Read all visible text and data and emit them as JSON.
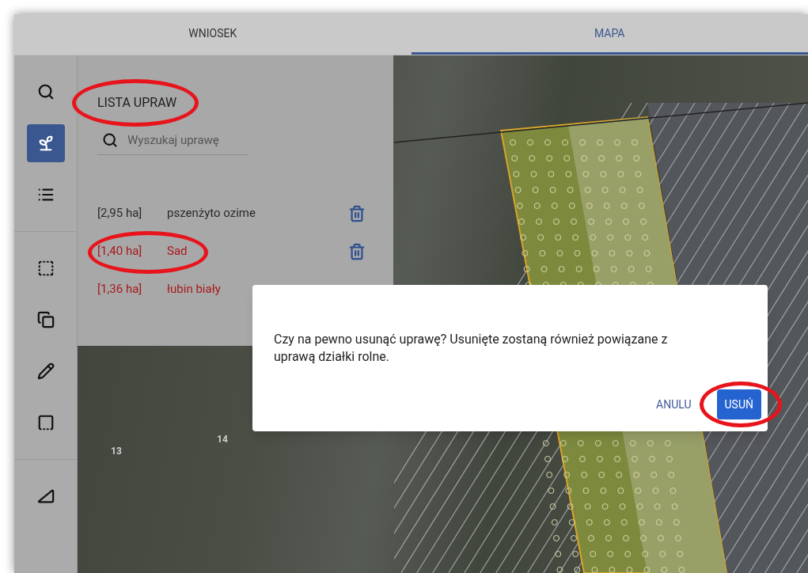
{
  "tabs": [
    {
      "label": "WNIOSEK",
      "selected": false
    },
    {
      "label": "MAPA",
      "selected": true
    }
  ],
  "toolbar": {
    "groups": [
      [
        {
          "kind": "search",
          "selected": false
        },
        {
          "kind": "crop",
          "selected": true
        },
        {
          "kind": "list",
          "selected": false
        }
      ],
      [
        {
          "kind": "select-area",
          "selected": false
        },
        {
          "kind": "copy",
          "selected": false
        },
        {
          "kind": "pencil",
          "selected": false
        },
        {
          "kind": "rectangle",
          "selected": false
        }
      ],
      [
        {
          "kind": "ruler",
          "selected": false
        }
      ]
    ]
  },
  "panel": {
    "title": "LISTA UPRAW",
    "title_highlighted": true,
    "search": {
      "placeholder": "Wyszukaj uprawę"
    },
    "crops": [
      {
        "area": "[2,95 ha]",
        "name": "pszenżyto ozime",
        "invalid": false,
        "deletable": true,
        "highlighted": false
      },
      {
        "area": "[1,40 ha]",
        "name": "Sad",
        "invalid": true,
        "deletable": true,
        "highlighted": true
      },
      {
        "area": "[1,36 ha]",
        "name": "łubin biały",
        "invalid": true,
        "deletable": false,
        "highlighted": false
      }
    ]
  },
  "map": {
    "labels": [
      "13",
      "14"
    ]
  },
  "dialog": {
    "message": "Czy na pewno usunąć uprawę? Usunięte zostaną również powiązane z uprawą działki rolne.",
    "buttons": [
      {
        "label": "ANULU",
        "kind": "text",
        "highlighted": false
      },
      {
        "label": "USUŃ",
        "kind": "primary",
        "highlighted": true
      }
    ]
  }
}
